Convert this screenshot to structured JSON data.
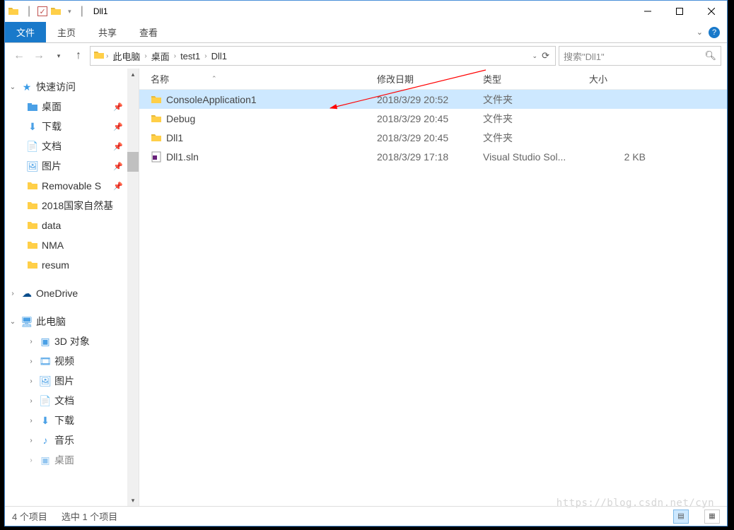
{
  "titlebar": {
    "title": "Dll1",
    "checkbox_checked": true
  },
  "ribbon": {
    "file": "文件",
    "tabs": [
      "主页",
      "共享",
      "查看"
    ]
  },
  "address": {
    "crumbs": [
      "此电脑",
      "桌面",
      "test1",
      "Dll1"
    ]
  },
  "search": {
    "placeholder": "搜索\"Dll1\""
  },
  "sidebar": {
    "quick_access": "快速访问",
    "quick_items": [
      {
        "label": "桌面",
        "pinned": true
      },
      {
        "label": "下载",
        "pinned": true
      },
      {
        "label": "文档",
        "pinned": true
      },
      {
        "label": "图片",
        "pinned": true
      },
      {
        "label": "Removable S",
        "pinned": true
      },
      {
        "label": "2018国家自然基",
        "pinned": false
      },
      {
        "label": "data",
        "pinned": false
      },
      {
        "label": "NMA",
        "pinned": false
      },
      {
        "label": "resum",
        "pinned": false
      }
    ],
    "onedrive": "OneDrive",
    "this_pc": "此电脑",
    "pc_items": [
      "3D 对象",
      "视频",
      "图片",
      "文档",
      "下载",
      "音乐",
      "桌面"
    ]
  },
  "columns": {
    "name": "名称",
    "date": "修改日期",
    "type": "类型",
    "size": "大小"
  },
  "files": [
    {
      "name": "ConsoleApplication1",
      "date": "2018/3/29 20:52",
      "type": "文件夹",
      "size": "",
      "selected": true,
      "icon": "folder"
    },
    {
      "name": "Debug",
      "date": "2018/3/29 20:45",
      "type": "文件夹",
      "size": "",
      "selected": false,
      "icon": "folder"
    },
    {
      "name": "Dll1",
      "date": "2018/3/29 20:45",
      "type": "文件夹",
      "size": "",
      "selected": false,
      "icon": "folder"
    },
    {
      "name": "Dll1.sln",
      "date": "2018/3/29 17:18",
      "type": "Visual Studio Sol...",
      "size": "2 KB",
      "selected": false,
      "icon": "sln"
    }
  ],
  "status": {
    "count": "4 个项目",
    "selected": "选中 1 个项目"
  },
  "watermark": "https://blog.csdn.net/cyn"
}
